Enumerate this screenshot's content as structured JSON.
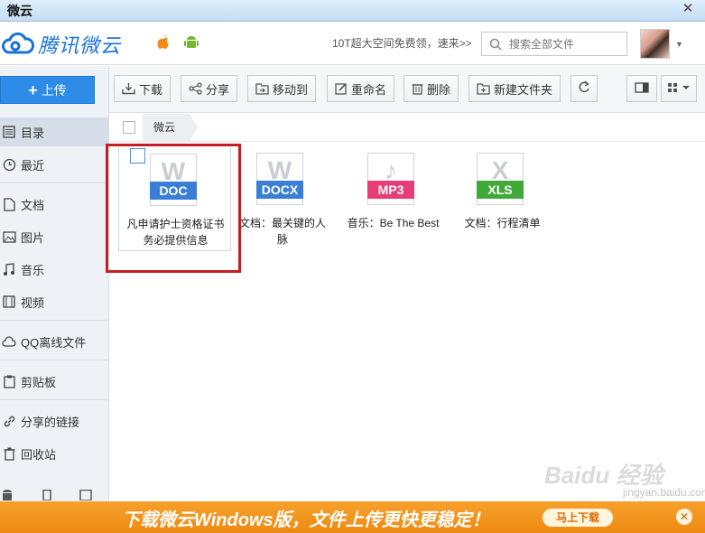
{
  "window": {
    "title": "微云",
    "close": "✕"
  },
  "header": {
    "logo_text": "腾讯微云",
    "promo": "10T超大空间免费领，速来>>",
    "search_placeholder": "搜索全部文件"
  },
  "sidebar": {
    "upload_label": "上传",
    "items": [
      {
        "label": "目录"
      },
      {
        "label": "最近"
      },
      {
        "label": "文档"
      },
      {
        "label": "图片"
      },
      {
        "label": "音乐"
      },
      {
        "label": "视频"
      },
      {
        "label": "QQ离线文件"
      },
      {
        "label": "剪贴板"
      },
      {
        "label": "分享的链接"
      },
      {
        "label": "回收站"
      }
    ]
  },
  "toolbar": {
    "download": "下载",
    "share": "分享",
    "move": "移动到",
    "rename": "重命名",
    "delete": "删除",
    "new_folder": "新建文件夹"
  },
  "breadcrumb": {
    "current": "微云"
  },
  "files": [
    {
      "type": "DOC",
      "glyph": "W",
      "color": "#3a7fd5",
      "name": "凡申请护士资格证书务必提供信息"
    },
    {
      "type": "DOCX",
      "glyph": "W",
      "color": "#3a7fd5",
      "name": "文档：最关键的人脉"
    },
    {
      "type": "MP3",
      "glyph": "♪",
      "color": "#e83c76",
      "name": "音乐：Be The Best"
    },
    {
      "type": "XLS",
      "glyph": "X",
      "color": "#3faa3a",
      "name": "文档：行程清单"
    }
  ],
  "banner": {
    "text": "下载微云Windows版，文件上传更快更稳定！",
    "button": "马上下载"
  },
  "watermark": {
    "brand": "Baidu 经验",
    "url": "jingyan.baidu.com"
  }
}
